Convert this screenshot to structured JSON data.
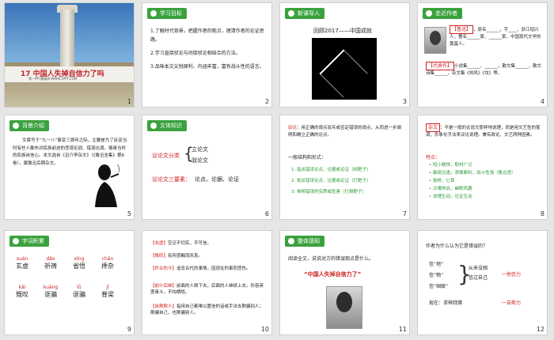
{
  "slides": [
    {
      "num": "1",
      "cover_title": "17 中国人失掉自信力了吗",
      "cover_sub": "第一PPT模板网·WWW.1PPT.COM"
    },
    {
      "num": "2",
      "tag": "学习目标",
      "items": [
        "1.了解时代背景，把握作者的观点，理清作者的论证思路。",
        "2.学习直接驳论与间接驳论相结合的方法。",
        "3.品味本文尖锐犀利、内涵丰富，富有战斗性的语言。"
      ]
    },
    {
      "num": "3",
      "tag": "新课导入",
      "caption": "回顾2017——中国成就"
    },
    {
      "num": "4",
      "tag": "走近作者",
      "label1": "【鲁迅】",
      "text1": "，原名______，字____，浙江绍兴人，著名______家、______家，中国现代文学的奠基人。",
      "label2": "【代表作】",
      "text2": "小说集______、______，散文集______，散文诗集______，杂文集《热风》《坟》等。"
    },
    {
      "num": "5",
      "tag": "背景介绍",
      "text": "文章写于“九一八”事变三周年之际，主要是为了反驳当时有些人散布对民族前途的悲观论调、错误论调，振奋当时的民族自信心。本文选自《且介亭杂文》（《鲁迅全集》第6卷），属鲁迅后期杂文。"
    },
    {
      "num": "6",
      "tag": "文体知识",
      "cls_label": "议论文分类",
      "cls_a": "立论文",
      "cls_b": "驳论文",
      "elem_label": "议论文三要素：",
      "elem_text": "论点、论据、论证"
    },
    {
      "num": "7",
      "def_label": "驳论",
      "def_text": "：用正确的观点驳斥或否定错误的观点，从而进一步阐明和确立正确的论点。",
      "struct": "一般结构和形式：",
      "steps": [
        "1. 指出错误论点、论据或论证（树靶子）",
        "2. 批驳错误论点、论据或论证（打靶子）",
        "3. 揭明错误的实质或危害（打倒靶子）"
      ]
    },
    {
      "num": "8",
      "tag_inline": "杂文",
      "intro": "：不是一般的论说文那样地说理，而是用文艺性的笔调，形象化手法来议论说理。兼有政论、文艺两种因素。",
      "feat_label": "特点：",
      "feats": [
        "短小精悍，取材广泛",
        "敏锐迅速，泼辣犀利，战斗性强（鲁迅语）",
        "投枪、匕首",
        "冷嘲热讽，幽默风趣",
        "说理生动，论证生动"
      ]
    },
    {
      "num": "9",
      "tag": "字词积累",
      "words": [
        {
          "py": "xuán",
          "han": "玄虚"
        },
        {
          "py": "dǎo",
          "han": "祈祷"
        },
        {
          "py": "xǐng",
          "han": "省悟"
        },
        {
          "py": "chān",
          "han": "搀杂"
        },
        {
          "py": "kǎi",
          "han": "慨叹"
        },
        {
          "py": "kuāng",
          "han": "诓骗"
        },
        {
          "py": "lǚ",
          "han": "诓骗"
        },
        {
          "py": "jǐ",
          "han": "脊梁"
        }
      ]
    },
    {
      "num": "10",
      "defs": [
        {
          "k": "【玄虚】",
          "v": "空泛不切实，不可信。"
        },
        {
          "k": "【慨叹】",
          "v": "有所感触而叹息。"
        },
        {
          "k": "【怀古伤今】",
          "v": "追念古代的事情，因现在的事而悲伤。"
        },
        {
          "k": "【前仆后继】",
          "v": "前面的人倒下去，后面的人继续上去。形容英勇奋斗，不怕牺牲。"
        },
        {
          "k": "【自欺欺人】",
          "v": "指用自己都难以置信的话或手法去欺骗别人；欺骗自己，也欺骗别人。"
        }
      ]
    },
    {
      "num": "11",
      "tag": "整体感知",
      "q": "阅读全文，说说对方的错误观点是什么。",
      "quote": "“中国人失掉自信力了”"
    },
    {
      "num": "12",
      "q": "作者为什么认为它是错误的？",
      "gods": [
        "信“地”",
        "信“物”",
        "信“国联”"
      ],
      "from": "从来没相",
      "self": "信过自己",
      "lost": "一他信力",
      "now_label": "现在：",
      "now": "求神拜佛",
      "conclusion": "一自欺力"
    }
  ]
}
